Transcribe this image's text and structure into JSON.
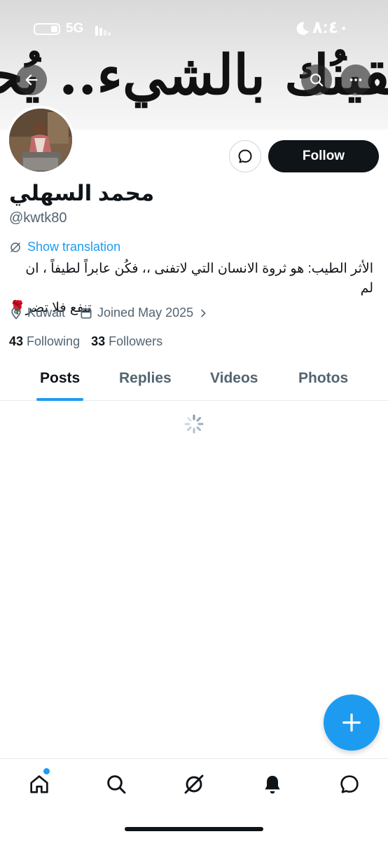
{
  "status_bar": {
    "network": "5G",
    "time": "٨:٤٠"
  },
  "banner": {
    "text": "يقينُك بالشيء.. يُحققه"
  },
  "profile": {
    "display_name": "محمد السهلي",
    "handle": "@kwtk80",
    "show_translation": "Show translation",
    "bio_line1": "الأثر الطيب: هو ثروة الانسان التي لاتفنى ،، فكُن عابراً لطيفاً ، ان لم",
    "bio_line2": "تنفع فلا تضر🌹",
    "location": "Kuwait",
    "joined": "Joined May 2025",
    "following_count": "43",
    "following_label": "Following",
    "followers_count": "33",
    "followers_label": "Followers"
  },
  "actions": {
    "follow_label": "Follow"
  },
  "tabs": [
    {
      "label": "Posts",
      "active": true
    },
    {
      "label": "Replies",
      "active": false
    },
    {
      "label": "Videos",
      "active": false
    },
    {
      "label": "Photos",
      "active": false
    }
  ],
  "bottom_nav": [
    "home-icon",
    "search-icon",
    "grok-icon",
    "notifications-icon",
    "messages-icon"
  ],
  "colors": {
    "accent": "#1d9bf0",
    "text_primary": "#0f1419",
    "text_secondary": "#536471"
  }
}
